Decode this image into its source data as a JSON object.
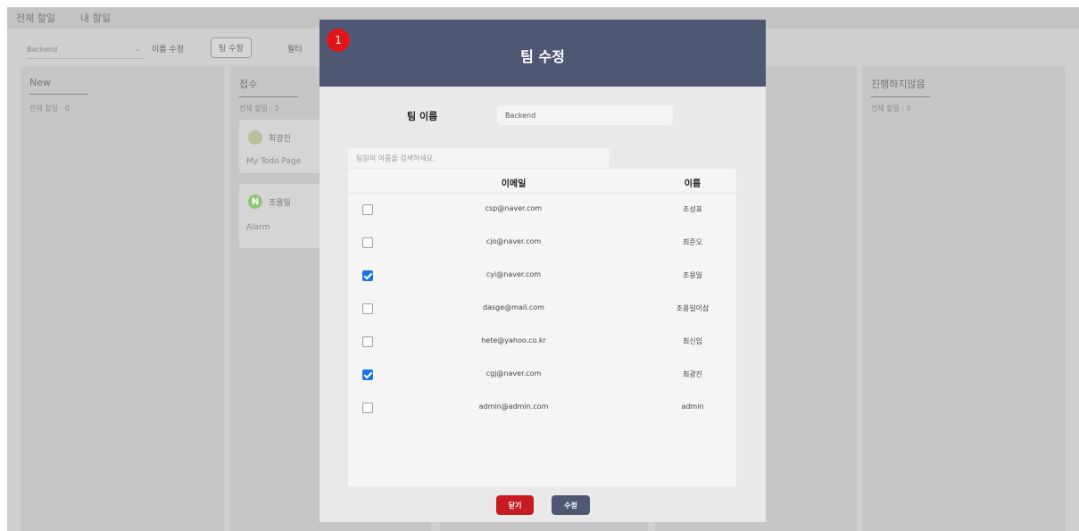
{
  "background": {
    "nav": {
      "all_todos": "전체 할일",
      "my_todos": "내 할일"
    },
    "toolbar": {
      "team_select_value": "Backend",
      "rename_label": "이름 수정",
      "team_edit_label": "팀 수정",
      "filter_label": "필터"
    },
    "columns": [
      {
        "title": "New",
        "count": "전체 할일 : 0"
      },
      {
        "title": "접수",
        "count": "전체 할일 : 2"
      },
      {
        "title": "진행하지않음",
        "count": "전체 할일 : 0"
      }
    ],
    "cards": [
      {
        "user": "최광진",
        "avatar_letter": "",
        "avatar_color": "#b6c09a",
        "title": "My Todo Page"
      },
      {
        "user": "조용일",
        "avatar_letter": "N",
        "avatar_color": "#8fc77c",
        "title": "Alarm"
      }
    ]
  },
  "modal": {
    "title": "팀 수정",
    "step_badge": "1",
    "team_name_label": "팀 이름",
    "team_name_value": "Backend",
    "search_placeholder": "팀원의 이름을 검색하세요.",
    "table": {
      "headers": {
        "email": "이메일",
        "name": "이름"
      },
      "rows": [
        {
          "email": "csp@naver.com",
          "name": "조성표",
          "checked": false
        },
        {
          "email": "cjo@naver.com",
          "name": "최준오",
          "checked": false
        },
        {
          "email": "cyi@naver.com",
          "name": "조용일",
          "checked": true
        },
        {
          "email": "dasge@mail.com",
          "name": "조용일이삼",
          "checked": false
        },
        {
          "email": "hete@yahoo.co.kr",
          "name": "최신입",
          "checked": false
        },
        {
          "email": "cgj@naver.com",
          "name": "최광진",
          "checked": true
        },
        {
          "email": "admin@admin.com",
          "name": "admin",
          "checked": false
        }
      ]
    },
    "buttons": {
      "close": "닫기",
      "submit": "수정"
    }
  },
  "colors": {
    "modal_header": "#4f5873",
    "close_button": "#c61a24",
    "submit_button": "#4f5873",
    "checkbox_checked": "#1a73e8",
    "step_badge": "#e0141a"
  }
}
